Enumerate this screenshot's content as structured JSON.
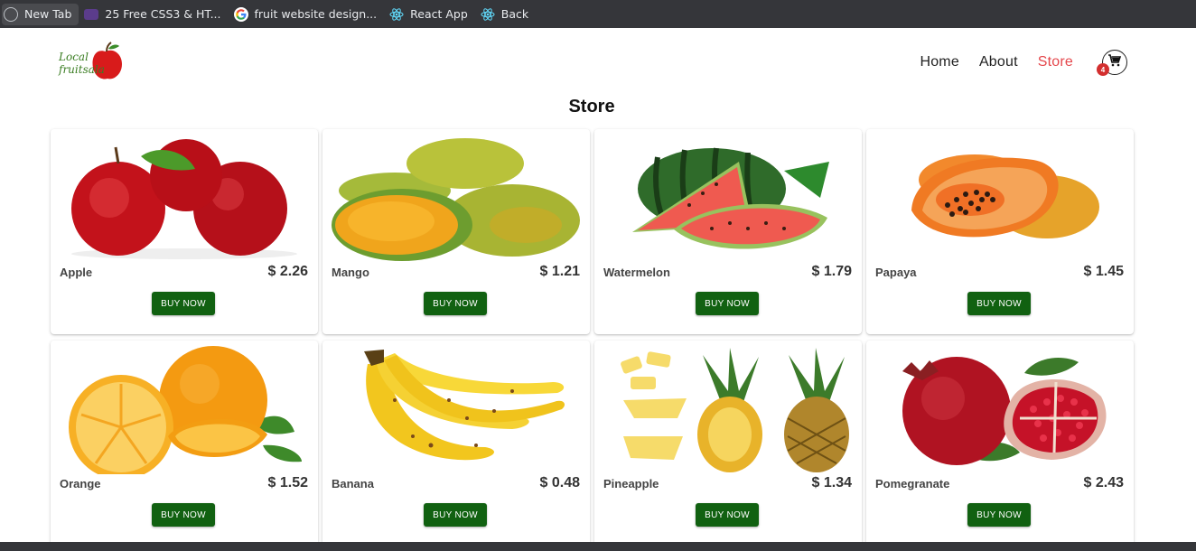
{
  "bookmarks": [
    {
      "label": "New Tab",
      "icon": "globe-icon"
    },
    {
      "label": "25 Free CSS3 & HT...",
      "icon": "codepen-logo-icon"
    },
    {
      "label": "fruit website design...",
      "icon": "google-icon"
    },
    {
      "label": "React App",
      "icon": "react-icon"
    },
    {
      "label": "Back",
      "icon": "react-icon"
    }
  ],
  "brand": {
    "line1": "Local",
    "line2": "fruitsala"
  },
  "nav": {
    "home": "Home",
    "about": "About",
    "store": "Store",
    "cart_count": "4"
  },
  "page_title": "Store",
  "products": [
    {
      "name": "Apple",
      "price": "$ 2.26",
      "button": "BUY NOW"
    },
    {
      "name": "Mango",
      "price": "$ 1.21",
      "button": "BUY NOW"
    },
    {
      "name": "Watermelon",
      "price": "$ 1.79",
      "button": "BUY NOW"
    },
    {
      "name": "Papaya",
      "price": "$ 1.45",
      "button": "BUY NOW"
    },
    {
      "name": "Orange",
      "price": "$ 1.52",
      "button": "BUY NOW"
    },
    {
      "name": "Banana",
      "price": "$ 0.48",
      "button": "BUY NOW"
    },
    {
      "name": "Pineapple",
      "price": "$ 1.34",
      "button": "BUY NOW"
    },
    {
      "name": "Pomegranate",
      "price": "$ 2.43",
      "button": "BUY NOW"
    }
  ],
  "colors": {
    "accent": "#e5484d",
    "button": "#116111",
    "badge": "#d32f2f"
  }
}
